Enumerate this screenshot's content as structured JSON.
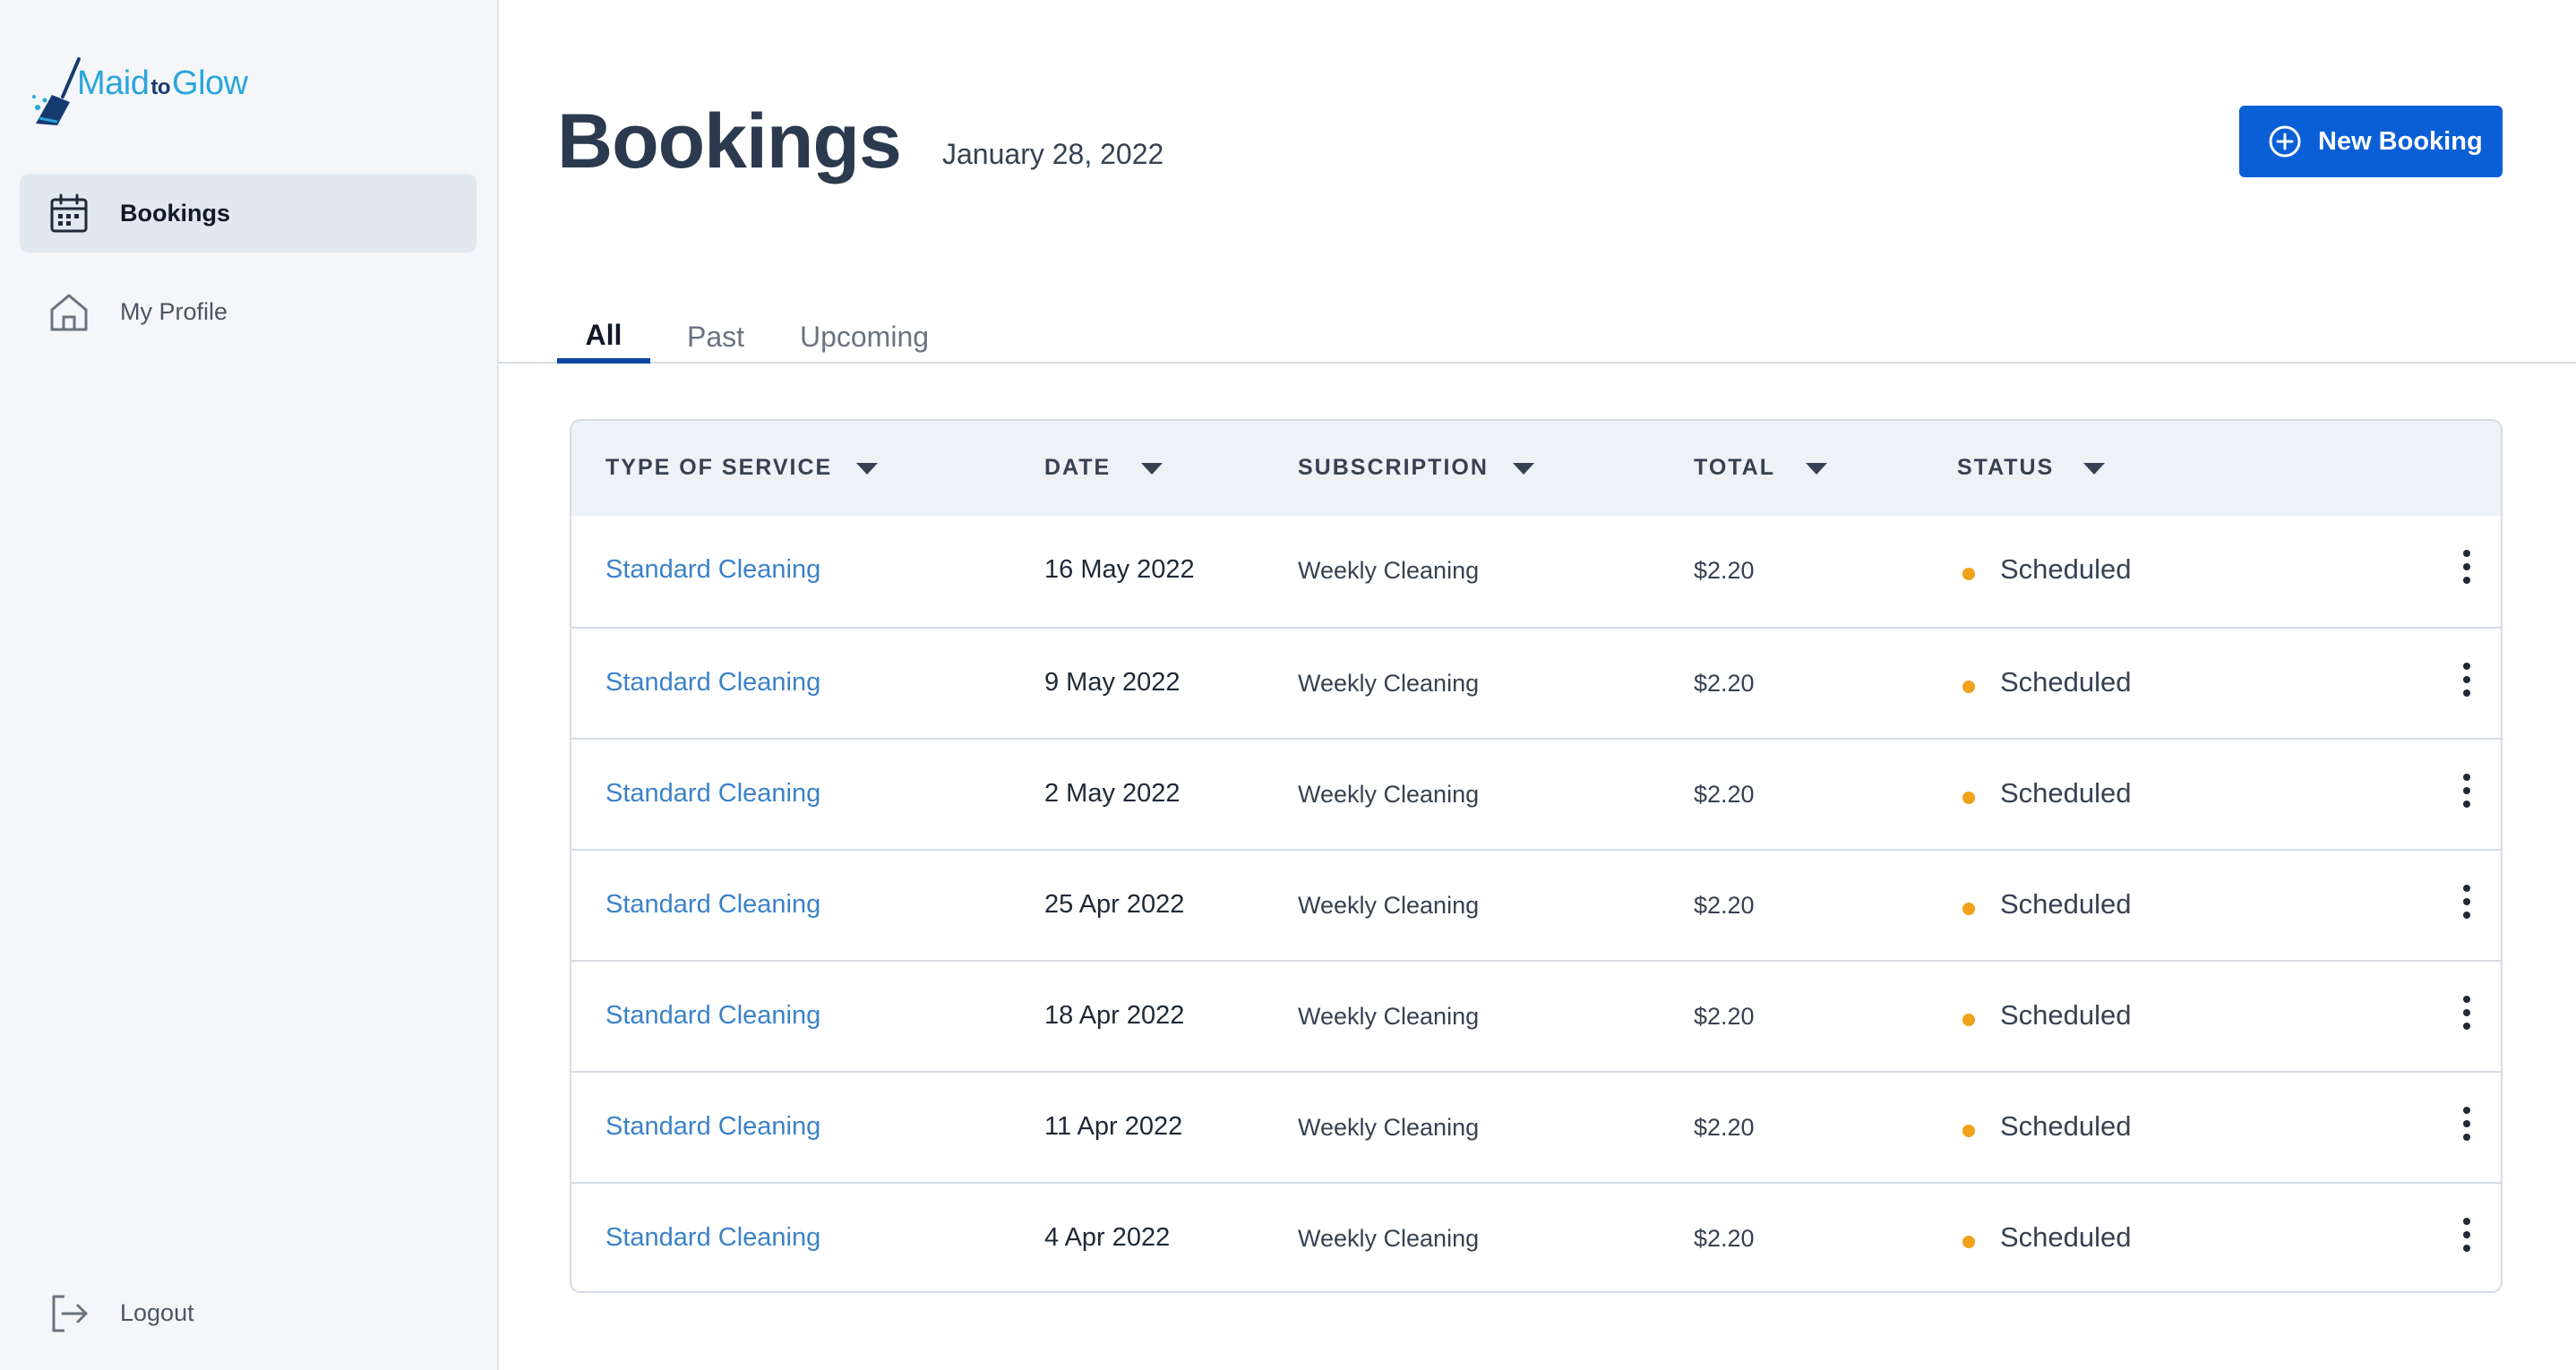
{
  "brand": {
    "logo_main_left": "Maid",
    "logo_to": "to",
    "logo_main_right": "Glow",
    "colors": {
      "primary": "#2aa6dc",
      "dark": "#173a6e"
    }
  },
  "sidebar": {
    "items": [
      {
        "label": "Bookings",
        "icon": "calendar-icon",
        "active": true
      },
      {
        "label": "My Profile",
        "icon": "home-icon",
        "active": false
      }
    ],
    "logout": {
      "label": "Logout",
      "icon": "logout-icon"
    }
  },
  "header": {
    "title": "Bookings",
    "date": "January 28, 2022",
    "new_booking_label": "New Booking",
    "accent": "#0a5fd6"
  },
  "tabs": [
    {
      "label": "All",
      "active": true
    },
    {
      "label": "Past",
      "active": false
    },
    {
      "label": "Upcoming",
      "active": false
    }
  ],
  "table": {
    "columns": [
      "TYPE OF SERVICE",
      "DATE",
      "SUBSCRIPTION",
      "TOTAL",
      "STATUS"
    ],
    "rows": [
      {
        "service": "Standard Cleaning",
        "date": "16 May 2022",
        "subscription": "Weekly Cleaning",
        "total": "$2.20",
        "status": "Scheduled"
      },
      {
        "service": "Standard Cleaning",
        "date": "9 May 2022",
        "subscription": "Weekly Cleaning",
        "total": "$2.20",
        "status": "Scheduled"
      },
      {
        "service": "Standard Cleaning",
        "date": "2 May 2022",
        "subscription": "Weekly Cleaning",
        "total": "$2.20",
        "status": "Scheduled"
      },
      {
        "service": "Standard Cleaning",
        "date": "25 Apr 2022",
        "subscription": "Weekly Cleaning",
        "total": "$2.20",
        "status": "Scheduled"
      },
      {
        "service": "Standard Cleaning",
        "date": "18 Apr 2022",
        "subscription": "Weekly Cleaning",
        "total": "$2.20",
        "status": "Scheduled"
      },
      {
        "service": "Standard Cleaning",
        "date": "11 Apr 2022",
        "subscription": "Weekly Cleaning",
        "total": "$2.20",
        "status": "Scheduled"
      },
      {
        "service": "Standard Cleaning",
        "date": "4 Apr 2022",
        "subscription": "Weekly Cleaning",
        "total": "$2.20",
        "status": "Scheduled"
      }
    ],
    "status_color": "#f0a21a"
  }
}
